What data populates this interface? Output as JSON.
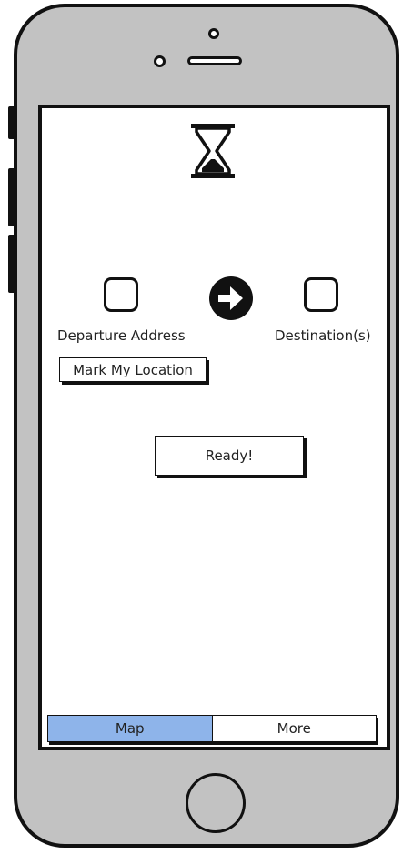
{
  "app": {
    "departure_label": "Departure Address",
    "destination_label": "Destination(s)",
    "mark_location_label": "Mark My Location",
    "ready_label": "Ready!"
  },
  "tabs": [
    {
      "label": "Map",
      "selected": true
    },
    {
      "label": "More",
      "selected": false
    }
  ],
  "colors": {
    "selected_tab": "#8eb4ea",
    "phone_body": "#c2c2c2",
    "outline": "#111111"
  },
  "icons": {
    "logo": "hourglass-icon",
    "direction": "arrow-right-circle-icon",
    "departure_checkbox": "checkbox-icon",
    "destination_checkbox": "checkbox-icon"
  }
}
